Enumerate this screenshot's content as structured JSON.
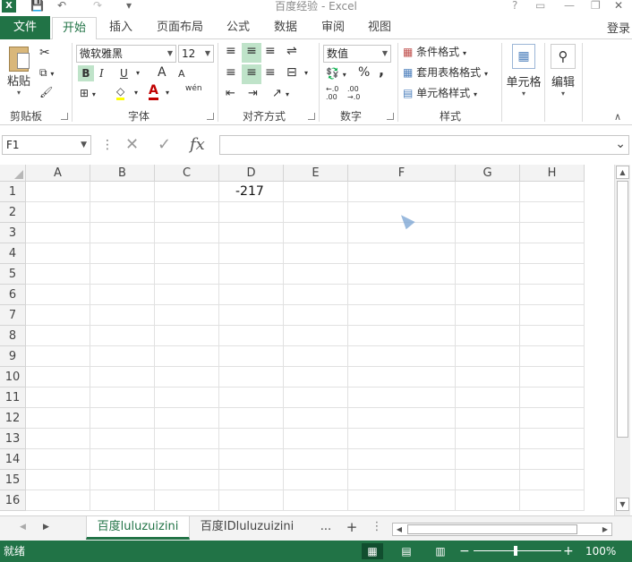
{
  "window": {
    "title": "百度经验 - Excel",
    "help": "?",
    "close": "✕",
    "qat": {
      "save": "💾",
      "undo": "↶",
      "redo": "↷",
      "more": "▾"
    }
  },
  "tabs": {
    "file": "文件",
    "items": [
      "开始",
      "插入",
      "页面布局",
      "公式",
      "数据",
      "审阅",
      "视图"
    ],
    "active": "开始",
    "signin": "登录"
  },
  "ribbon": {
    "clipboard": {
      "paste": "粘贴",
      "label": "剪贴板"
    },
    "font": {
      "name": "微软雅黑",
      "size": "12",
      "bold": "B",
      "italic": "I",
      "underline": "U",
      "grow": "A",
      "shrink": "A",
      "font_color": "A",
      "phonetic": "wén",
      "label": "字体"
    },
    "alignment": {
      "label": "对齐方式"
    },
    "number": {
      "format": "数值",
      "percent": "%",
      "comma": ",",
      "label": "数字"
    },
    "styles": {
      "conditional": "条件格式",
      "table": "套用表格格式",
      "cell_styles": "单元格样式",
      "label": "样式"
    },
    "cells": {
      "label": "单元格"
    },
    "editing": {
      "label": "编辑"
    }
  },
  "formula_bar": {
    "name_box": "F1",
    "fx": "fx",
    "value": ""
  },
  "grid": {
    "columns": [
      "A",
      "B",
      "C",
      "D",
      "E",
      "F",
      "G",
      "H"
    ],
    "rows": [
      "1",
      "2",
      "3",
      "4",
      "5",
      "6",
      "7",
      "8",
      "9",
      "10",
      "11",
      "12",
      "13",
      "14",
      "15",
      "16"
    ],
    "cells": {
      "D1": "-217"
    }
  },
  "sheets": {
    "tabs": [
      "百度luluzuizini",
      "百度IDluluzuizini"
    ],
    "active": "百度luluzuizini",
    "more": "...",
    "add": "+"
  },
  "status": {
    "text": "就绪",
    "zoom": "100%",
    "zoom_fraction": 0.5
  },
  "colors": {
    "accent": "#217346",
    "selected_fill": "#bfe3c9"
  }
}
